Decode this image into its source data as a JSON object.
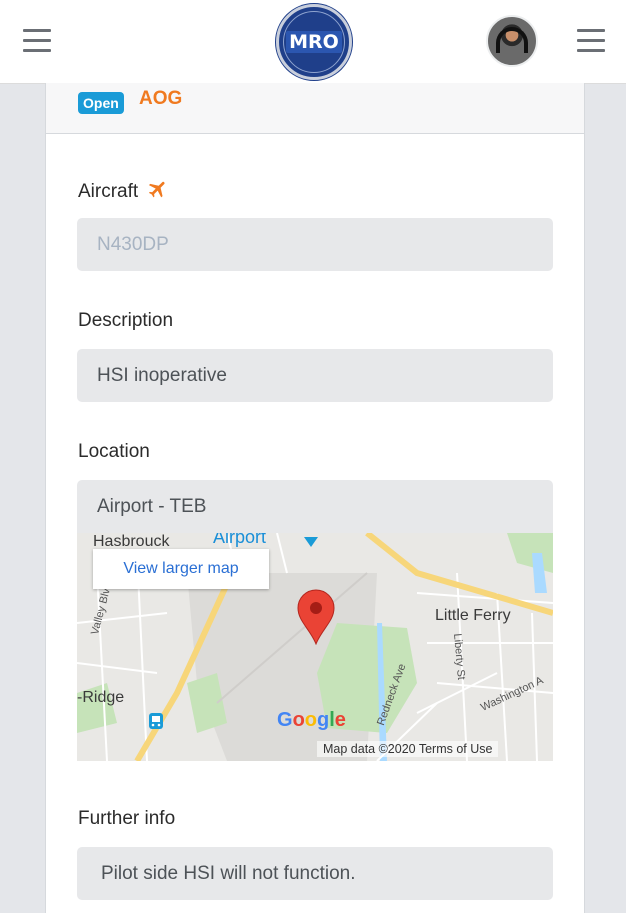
{
  "header": {
    "logo_text": "MRO",
    "left_menu_icon": "hamburger-menu-icon",
    "right_menu_icon": "hamburger-menu-icon"
  },
  "ticket": {
    "status_badge": "Open",
    "priority": "AOG",
    "badge_color": "#1a9bd7",
    "priority_color": "#f07a20"
  },
  "form": {
    "aircraft": {
      "label": "Aircraft",
      "value": "N430DP",
      "icon": "airplane-icon"
    },
    "description": {
      "label": "Description",
      "value": "HSI inoperative"
    },
    "location": {
      "label": "Location",
      "value": "Airport - TEB"
    },
    "further_info": {
      "label": "Further info",
      "value": "Pilot side HSI will not function."
    }
  },
  "map": {
    "view_larger": "View larger map",
    "places": {
      "hasbrouck": "Hasbrouck",
      "airport": "Airport",
      "little_ferry": "Little Ferry",
      "ridge": "-Ridge"
    },
    "streets": {
      "valley_blvd": "Valley Blvd",
      "liberty_st": "Liberty St",
      "washington": "Washington A",
      "redneck_ave": "Redneck Ave"
    },
    "google": "Google",
    "footer": "Map data ©2020   Terms of Use"
  }
}
